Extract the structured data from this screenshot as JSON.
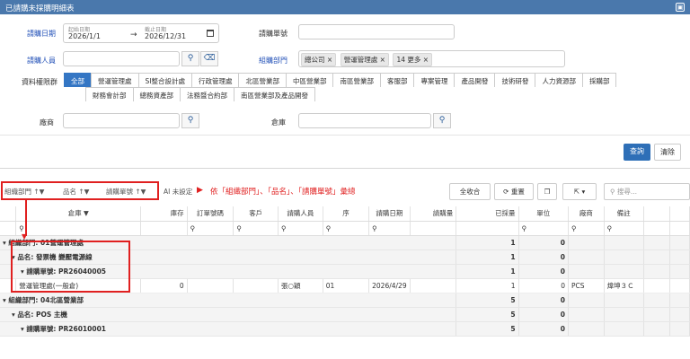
{
  "window": {
    "title": "已請購未採購明細表",
    "minimize_icon": "▣"
  },
  "form": {
    "date_label": "請購日期",
    "date_start_hint": "起始日期",
    "date_start": "2026/1/1",
    "date_arrow": "→",
    "date_end_hint": "截止日期",
    "date_end": "2026/12/31",
    "req_no_label": "請購單號",
    "requester_label": "請購人員",
    "dept_label": "組購部門",
    "dept_tags": [
      "總公司",
      "營運管理處",
      "14 更多"
    ],
    "scope_label": "資料權限群",
    "scope_tabs": [
      "全部",
      "營運管理處",
      "SI整合設計處",
      "行政管理處",
      "北區營業部",
      "中區營業部",
      "南區營業部",
      "客服部",
      "專案管理",
      "產品開發",
      "技術研發",
      "人力資源部",
      "採購部",
      "財務會計部",
      "總務資產部",
      "法務暨合約部",
      "南區營業部及產品開發"
    ],
    "vendor_label": "廠商",
    "warehouse_label": "倉庫",
    "query_btn": "查詢",
    "clear_btn": "清除"
  },
  "toolbar": {
    "group_chips": [
      "組織部門",
      "品名",
      "請購單號"
    ],
    "ai_text": "AI 未設定",
    "note": "依「組織部門」、「品名」、「請購單號」彙總",
    "collapse_all": "全收合",
    "reset": "重置",
    "search_placeholder": "搜尋..."
  },
  "grid": {
    "columns": [
      "倉庫",
      "庫存",
      "訂單號碼",
      "客戶",
      "請購人員",
      "序",
      "請購日期",
      "請購量",
      "已採量",
      "單位",
      "廠商",
      "備註"
    ],
    "rows": [
      {
        "kind": "g1",
        "label": "組織部門: 01營運管理處",
        "qty": "1",
        "bought": "0"
      },
      {
        "kind": "g2",
        "label": "品名: 發票機 變壓電源線",
        "qty": "1",
        "bought": "0"
      },
      {
        "kind": "g3",
        "label": "請購單號: PR26040005",
        "qty": "1",
        "bought": "0"
      },
      {
        "kind": "d",
        "warehouse": "營運管理處(一般倉)",
        "stock": "0",
        "requester": "張○穎",
        "seq": "01",
        "date": "2026/4/29",
        "qty": "1",
        "bought": "0",
        "unit": "PCS",
        "vendor": "煒坤３Ｃ"
      },
      {
        "kind": "g1",
        "label": "組織部門: 04北區營業部",
        "qty": "5",
        "bought": "0"
      },
      {
        "kind": "g2",
        "label": "品名: POS 主機",
        "qty": "5",
        "bought": "0"
      },
      {
        "kind": "g3",
        "label": "請購單號: PR26010001",
        "qty": "5",
        "bought": "0"
      }
    ]
  }
}
